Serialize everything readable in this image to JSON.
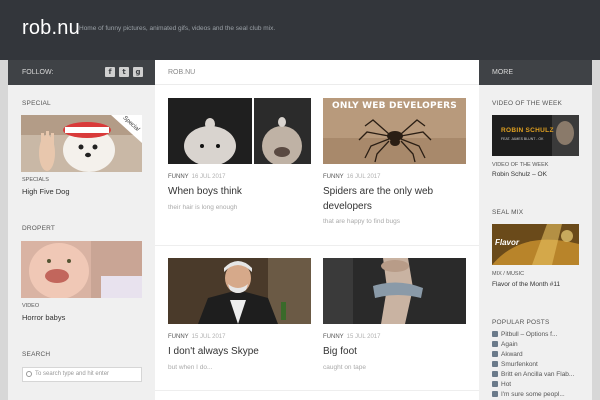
{
  "header": {
    "site_title": "rob.nu",
    "tagline": "Home of funny pictures, animated gifs, videos and the seal club mix."
  },
  "topbar": {
    "follow_label": "FOLLOW:",
    "section_label": "ROB.NU",
    "more_label": "MORE",
    "social_icons": [
      "facebook-icon",
      "twitter-icon",
      "google-plus-icon"
    ]
  },
  "left_sidebar": {
    "special": {
      "heading": "SPECIAL",
      "badge": "Special",
      "category": "SPECIALS",
      "title": "High Five Dog"
    },
    "dropert": {
      "heading": "DROPERT",
      "category": "VIDEO",
      "title": "Horror babys"
    },
    "search": {
      "heading": "SEARCH",
      "placeholder": "To search type and hit enter"
    }
  },
  "right_sidebar": {
    "video": {
      "heading": "VIDEO OF THE WEEK",
      "overlay": "ROBIN SCHULZ",
      "overlay_sub": "FEAT. JAMES BLUNT - OK",
      "category": "VIDEO OF THE WEEK",
      "title": "Robin Schulz – OK"
    },
    "seal_mix": {
      "heading": "SEAL MIX",
      "overlay": "Flavor",
      "category": "MIX / MUSIC",
      "title": "Flavor of the Month #11"
    },
    "popular": {
      "heading": "POPULAR POSTS",
      "items": [
        "Pitbull – Options f...",
        "Again",
        "Akward",
        "Smurfenkont",
        "Britt en Ancilla van Flab...",
        "Hot",
        "I'm sure some peopl..."
      ]
    }
  },
  "posts": [
    {
      "category": "FUNNY",
      "date": "16 JUL 2017",
      "title": "When boys think",
      "excerpt": "their  hair is long enough"
    },
    {
      "category": "FUNNY",
      "date": "16 JUL 2017",
      "title": "Spiders are the only web developers",
      "excerpt": "that are happy to find bugs",
      "image_caption": "ONLY WEB DEVELOPERS"
    },
    {
      "category": "FUNNY",
      "date": "15 JUL 2017",
      "title": "I don't always Skype",
      "excerpt": "but when I do..."
    },
    {
      "category": "FUNNY",
      "date": "15 JUL 2017",
      "title": "Big foot",
      "excerpt": "caught on tape"
    }
  ]
}
